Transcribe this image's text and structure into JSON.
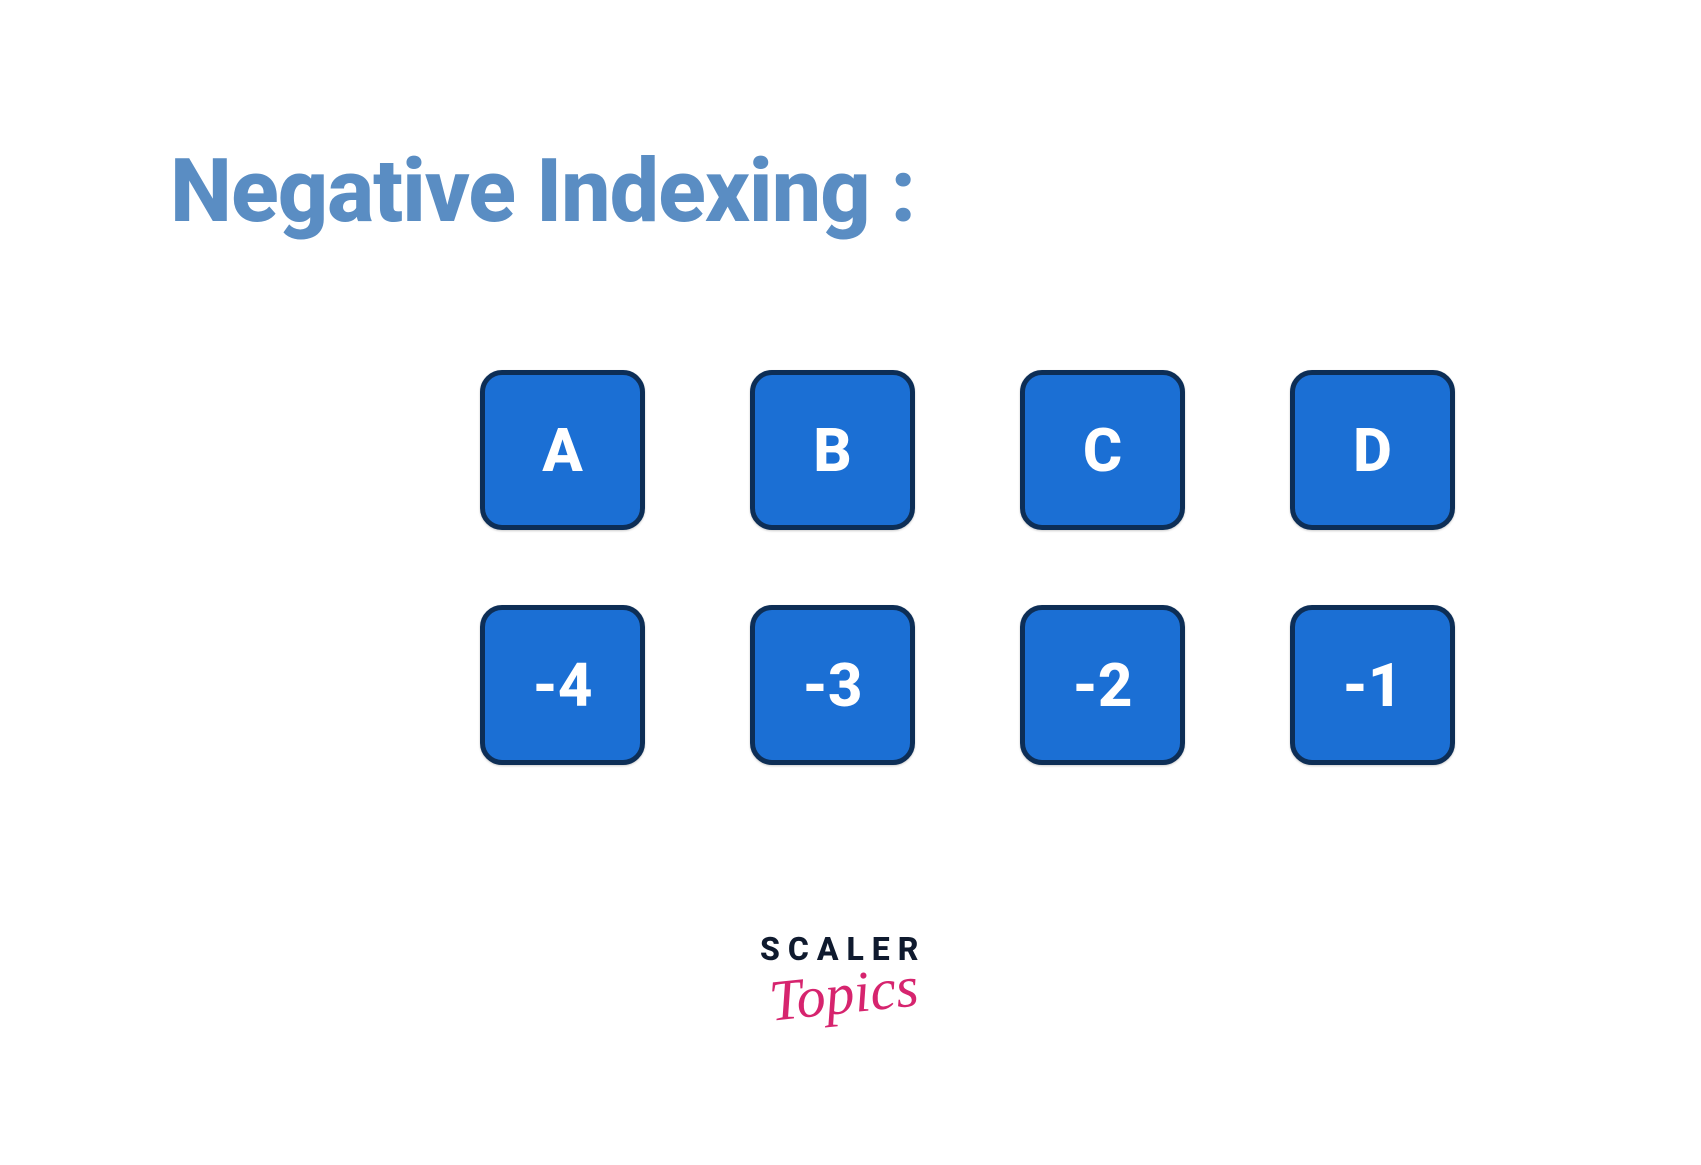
{
  "title": "Negative Indexing :",
  "letters": [
    "A",
    "B",
    "C",
    "D"
  ],
  "indices": [
    "-4",
    "-3",
    "-2",
    "-1"
  ],
  "logo": {
    "line1": "SCALER",
    "line2": "Topics"
  },
  "colors": {
    "title_color": "#5a8dc3",
    "tile_bg": "#1b6fd4",
    "tile_border": "#0d2e56",
    "tile_text": "#ffffff",
    "logo_primary": "#0f1a2e",
    "logo_accent": "#d6246e"
  }
}
